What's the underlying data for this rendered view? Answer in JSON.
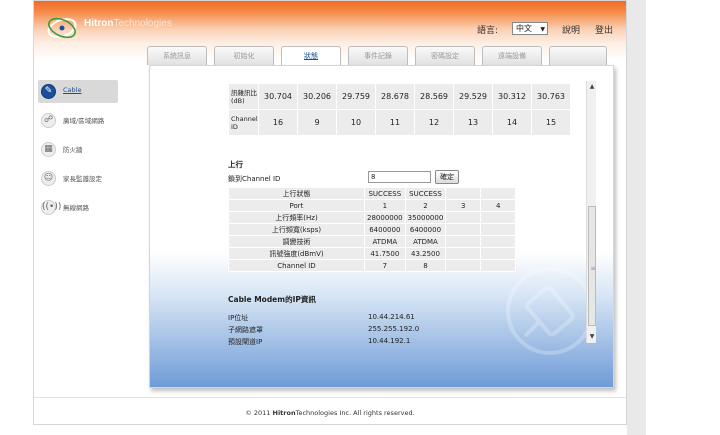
{
  "header": {
    "brand_bold": "Hitron",
    "brand_rest": "Technologies",
    "language_label": "語言:",
    "language_value": "中文",
    "help_label": "說明",
    "logout_label": "登出"
  },
  "tabs": [
    {
      "label": "系統訊息",
      "active": false
    },
    {
      "label": "初始化",
      "active": false
    },
    {
      "label": "狀態",
      "active": true
    },
    {
      "label": "事件記錄",
      "active": false
    },
    {
      "label": "密碼設定",
      "active": false
    },
    {
      "label": "遠端設備",
      "active": false
    }
  ],
  "sidebar": {
    "items": [
      {
        "label": "Cable",
        "icon": "cable-icon",
        "active": true
      },
      {
        "label": "廣域/區域網路",
        "icon": "network-icon",
        "active": false
      },
      {
        "label": "防火牆",
        "icon": "firewall-icon",
        "active": false
      },
      {
        "label": "家長監護設定",
        "icon": "parental-icon",
        "active": false
      },
      {
        "label": "無線網路",
        "icon": "wireless-icon",
        "active": false
      }
    ]
  },
  "downstream": {
    "snr_label": "訊雜訊比(dB)",
    "snr_values": [
      "30.704",
      "30.206",
      "29.759",
      "28.678",
      "28.569",
      "29.529",
      "30.312",
      "30.763"
    ],
    "channel_label": "Channel ID",
    "channel_values": [
      "16",
      "9",
      "10",
      "11",
      "12",
      "13",
      "14",
      "15"
    ]
  },
  "upstream": {
    "title": "上行",
    "lock_label": "鎖到Channel ID",
    "lock_value": "8",
    "ok_label": "確定",
    "rows": [
      {
        "label": "上行狀態",
        "values": [
          "SUCCESS",
          "SUCCESS",
          "",
          ""
        ]
      },
      {
        "label": "Port",
        "values": [
          "1",
          "2",
          "3",
          "4"
        ]
      },
      {
        "label": "上行頻率(Hz)",
        "values": [
          "28000000",
          "35000000",
          "",
          ""
        ]
      },
      {
        "label": "上行頻寬(ksps)",
        "values": [
          "6400000",
          "6400000",
          "",
          ""
        ]
      },
      {
        "label": "調變技術",
        "values": [
          "ATDMA",
          "ATDMA",
          "",
          ""
        ]
      },
      {
        "label": "訊號強度(dBmV)",
        "values": [
          "41.7500",
          "43.2500",
          "",
          ""
        ]
      },
      {
        "label": "Channel ID",
        "values": [
          "7",
          "8",
          "",
          ""
        ]
      }
    ]
  },
  "cable_modem": {
    "title": "Cable Modem的IP資訊",
    "rows": [
      {
        "label": "IP位址",
        "value": "10.44.214.61"
      },
      {
        "label": "子網路遮罩",
        "value": "255.255.192.0"
      },
      {
        "label": "預設閘道IP",
        "value": "10.44.192.1"
      }
    ]
  },
  "footer": {
    "prefix": "© 2011",
    "brand_bold": "Hitron",
    "brand_rest": "Technologies",
    "suffix": "Inc.  All rights reserved."
  },
  "colors": {
    "header_orange": "#f26a24",
    "accent_blue": "#1c4f9b",
    "panel_gradient_blue": "#6f9bd7"
  }
}
